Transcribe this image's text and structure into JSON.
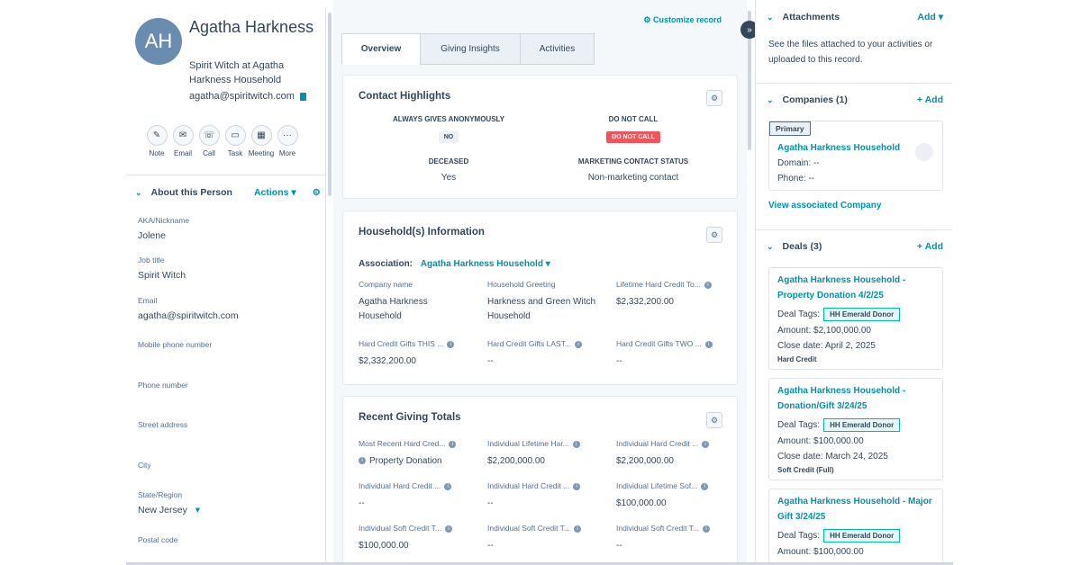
{
  "contact": {
    "initials": "AH",
    "name": "Agatha Harkness",
    "subtitle": "Spirit Witch at Agatha Harkness Household",
    "email": "agatha@spiritwitch.com"
  },
  "quick_actions": [
    "Note",
    "Email",
    "Call",
    "Task",
    "Meeting",
    "More"
  ],
  "about": {
    "title": "About this Person",
    "actions_label": "Actions",
    "fields": [
      {
        "label": "AKA/Nickname",
        "value": "Jolene"
      },
      {
        "label": "Job title",
        "value": "Spirit Witch"
      },
      {
        "label": "Email",
        "value": "agatha@spiritwitch.com"
      },
      {
        "label": "Mobile phone number",
        "value": ""
      },
      {
        "label": "Phone number",
        "value": ""
      },
      {
        "label": "Street address",
        "value": ""
      },
      {
        "label": "City",
        "value": ""
      },
      {
        "label": "State/Region",
        "value": "New Jersey"
      },
      {
        "label": "Postal code",
        "value": ""
      }
    ]
  },
  "customize_label": "Customize record",
  "tabs": [
    "Overview",
    "Giving Insights",
    "Activities"
  ],
  "highlights": {
    "title": "Contact Highlights",
    "items": [
      {
        "label": "ALWAYS GIVES ANONYMOUSLY",
        "value": "NO"
      },
      {
        "label": "DO NOT CALL",
        "value": "DO NOT CALL"
      },
      {
        "label": "DECEASED",
        "value": "Yes"
      },
      {
        "label": "MARKETING CONTACT STATUS",
        "value": "Non-marketing contact"
      }
    ]
  },
  "household": {
    "title": "Household(s) Information",
    "association_label": "Association:",
    "association_value": "Agatha Harkness Household",
    "cells": [
      {
        "label": "Company name",
        "value": "Agatha Harkness Household"
      },
      {
        "label": "Household Greeting",
        "value": "Harkness and Green Witch Household"
      },
      {
        "label": "Lifetime Hard Credit To...",
        "value": "$2,332,200.00"
      },
      {
        "label": "Hard Credit Gifts THIS ...",
        "value": "$2,332,200.00"
      },
      {
        "label": "Hard Credit Gifts LAST...",
        "value": "--"
      },
      {
        "label": "Hard Credit Gifts TWO ...",
        "value": "--"
      }
    ]
  },
  "giving": {
    "title": "Recent Giving Totals",
    "cells": [
      {
        "label": "Most Recent Hard Cred...",
        "value": "Property Donation"
      },
      {
        "label": "Individual Lifetime Har...",
        "value": "$2,200,000.00"
      },
      {
        "label": "Individual Hard Credit ...",
        "value": "$2,200,000.00"
      },
      {
        "label": "Individual Hard Credit ...",
        "value": "--"
      },
      {
        "label": "Individual Hard Credit ...",
        "value": "--"
      },
      {
        "label": "Individual Lifetime Sof...",
        "value": "$100,000.00"
      },
      {
        "label": "Individual Soft Credit T...",
        "value": "$100,000.00"
      },
      {
        "label": "Individual Soft Credit T...",
        "value": "--"
      },
      {
        "label": "Individual Soft Credit T...",
        "value": "--"
      }
    ]
  },
  "attachments": {
    "title": "Attachments",
    "add_label": "Add",
    "text": "See the files attached to your activities or uploaded to this record."
  },
  "companies": {
    "title": "Companies (1)",
    "add_label": "+ Add",
    "primary_label": "Primary",
    "name": "Agatha Harkness Household",
    "domain": "Domain: --",
    "phone": "Phone: --",
    "view_label": "View associated Company"
  },
  "deals": {
    "title": "Deals (3)",
    "add_label": "+ Add",
    "tags_label": "Deal Tags:",
    "items": [
      {
        "name": "Agatha Harkness Household - Property Donation 4/2/25",
        "tag": "HH Emerald Donor",
        "amount": "Amount: $2,100,000.00",
        "close": "Close date: April 2, 2025",
        "credit": "Hard Credit"
      },
      {
        "name": "Agatha Harkness Household - Donation/Gift 3/24/25",
        "tag": "HH Emerald Donor",
        "amount": "Amount: $100,000.00",
        "close": "Close date: March 24, 2025",
        "credit": "Soft Credit (Full)"
      },
      {
        "name": "Agatha Harkness Household - Major Gift 3/24/25",
        "tag": "HH Emerald Donor",
        "amount": "Amount: $100,000.00",
        "close": "",
        "credit": ""
      }
    ]
  }
}
